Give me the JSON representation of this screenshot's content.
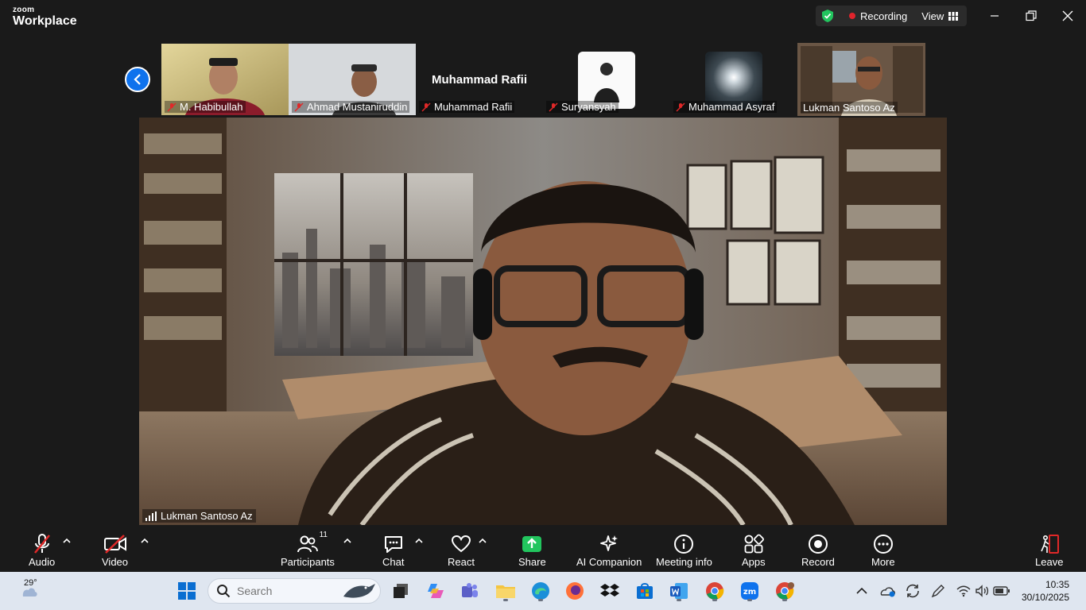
{
  "app": {
    "logo_top": "zoom",
    "logo_bottom": "Workplace",
    "recording": "Recording",
    "view": "View"
  },
  "colors": {
    "accent": "#0e72ed",
    "active_speaker": "#22c55e",
    "recording": "#e0242c",
    "muted": "#e02828"
  },
  "gallery": [
    {
      "name": "M. Habibullah",
      "muted": true,
      "kind": "video"
    },
    {
      "name": "Ahmad Mustaniruddin",
      "muted": true,
      "kind": "video"
    },
    {
      "name": "Muhammad Rafii",
      "muted": true,
      "kind": "name",
      "display": "Muhammad Rafii"
    },
    {
      "name": "Suryansyah",
      "muted": true,
      "kind": "avatar"
    },
    {
      "name": "Muhammad Asyraf",
      "muted": true,
      "kind": "avatar"
    },
    {
      "name": "Lukman Santoso Az",
      "muted": false,
      "kind": "video",
      "active": true
    }
  ],
  "main_speaker": {
    "name": "Lukman Santoso Az"
  },
  "toolbar": {
    "audio": "Audio",
    "video": "Video",
    "participants": "Participants",
    "participants_count": "11",
    "chat": "Chat",
    "react": "React",
    "share": "Share",
    "ai_companion": "AI Companion",
    "meeting_info": "Meeting info",
    "apps": "Apps",
    "record": "Record",
    "more": "More",
    "leave": "Leave"
  },
  "taskbar": {
    "weather": "29°",
    "search_placeholder": "Search",
    "time": "10:35",
    "date": "30/10/2025"
  }
}
